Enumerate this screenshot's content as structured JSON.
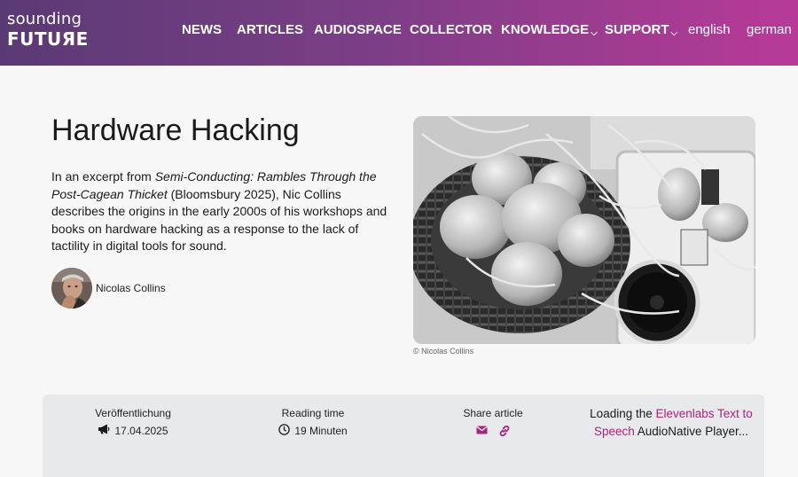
{
  "header": {
    "logo_top": "sounding",
    "logo_bottom": "FUTUЯE",
    "nav": [
      {
        "label": "NEWS"
      },
      {
        "label": "ARTICLES"
      },
      {
        "label": "AUDIOSPACE"
      },
      {
        "label": "COLLECTOR"
      },
      {
        "label": "KNOWLEDGE",
        "has_dropdown": true
      },
      {
        "label": "SUPPORT",
        "has_dropdown": true
      }
    ],
    "languages": [
      "english",
      "german"
    ],
    "gradient_colors": [
      "#5a3a74",
      "#b83a98"
    ]
  },
  "article": {
    "title": "Hardware Hacking",
    "excerpt_pre": "In an excerpt from ",
    "excerpt_book": "Semi-Conducting: Rambles Through the Post-Cagean Thicket",
    "excerpt_post": " (Bloomsbury 2025), Nic Collins describes the origins in the early 2000s of his workshops and books on hardware hacking as a response to the lack of tactility in digital tools for sound.",
    "author": "Nicolas Collins",
    "image_caption": "© Nicolas Collins"
  },
  "meta": {
    "publication_label": "Veröffentlichung",
    "publication_date": "17.04.2025",
    "publication_icon": "megaphone-icon",
    "reading_label": "Reading time",
    "reading_time": "19 Minuten",
    "reading_icon": "clock-icon",
    "share_label": "Share article",
    "share_icons": [
      "email-icon",
      "link-icon"
    ],
    "tts_prefix": "Loading the ",
    "tts_link": "Elevenlabs Text to Speech",
    "tts_suffix": " AudioNative Player...",
    "accent_color": "#a8247e"
  }
}
